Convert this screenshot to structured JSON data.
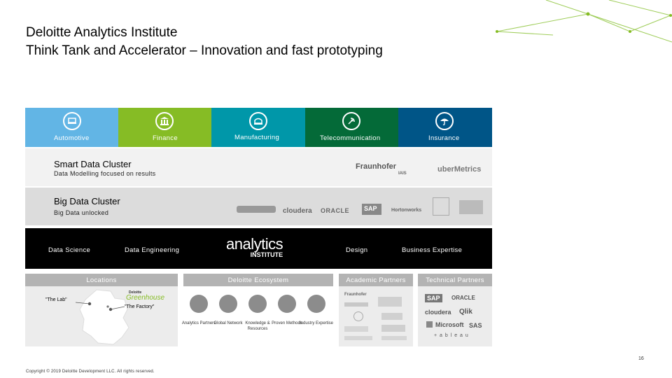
{
  "header": {
    "title_line1": "Deloitte Analytics Institute",
    "title_line2": "Think Tank and Accelerator – Innovation and fast prototyping"
  },
  "sectors": [
    {
      "label": "Automotive",
      "color": "#62b5e5",
      "icon": "car-icon"
    },
    {
      "label": "Finance",
      "color": "#86bc25",
      "icon": "bank-icon"
    },
    {
      "label": "Manufacturing",
      "color": "#0097a9",
      "icon": "factory-icon"
    },
    {
      "label": "Telecommunication",
      "color": "#046a38",
      "icon": "satellite-icon"
    },
    {
      "label": "Insurance",
      "color": "#005587",
      "icon": "umbrella-icon"
    }
  ],
  "smart_data": {
    "title": "Smart Data Cluster",
    "subtitle": "Data Modelling focused on results",
    "logos": [
      "Fraunhofer",
      "IAIS",
      "uberMetrics"
    ]
  },
  "big_data": {
    "title": "Big Data Cluster",
    "subtitle": "Big Data unlocked",
    "logos": [
      "cloudera",
      "ORACLE",
      "SAP",
      "Hortonworks"
    ]
  },
  "capabilities": {
    "items": [
      "Data Science",
      "Data Engineering",
      "Design",
      "Business Expertise"
    ],
    "logo_main": "analytics",
    "logo_sub": "INSTITUTE"
  },
  "locations": {
    "header": "Locations",
    "lab": "\"The Lab\"",
    "factory": "\"The Factory\"",
    "greenhouse_brand": "Deloitte",
    "greenhouse": "Greenhouse"
  },
  "ecosystem": {
    "header": "Deloitte Ecosystem",
    "items": [
      "Analytics Partners",
      "Global Network",
      "Knowledge & Resources",
      "Proven Methods",
      "Industry Expertise"
    ]
  },
  "academic": {
    "header": "Academic Partners",
    "logos": [
      "Fraunhofer"
    ]
  },
  "technical": {
    "header": "Technical Partners",
    "logos": [
      "SAP",
      "ORACLE",
      "cloudera",
      "Qlik",
      "Microsoft",
      "SAS",
      "+ a b l e a u"
    ]
  },
  "footer": {
    "page": "16",
    "copyright": "Copyright © 2019 Deloitte Development LLC. All rights reserved."
  }
}
